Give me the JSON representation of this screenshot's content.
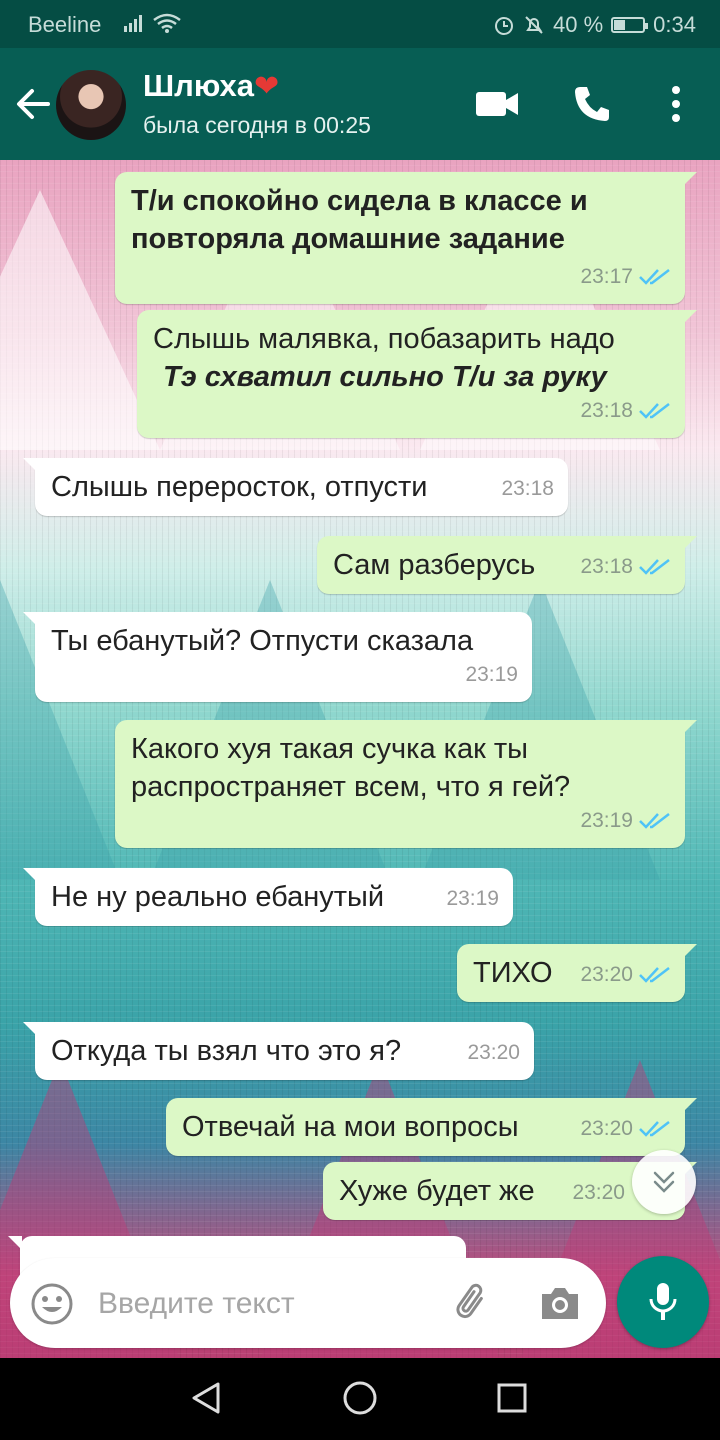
{
  "status_bar": {
    "carrier": "Beeline",
    "battery_text": "40 %",
    "battery_level": 0.4,
    "time": "0:34"
  },
  "header": {
    "contact_name": "Шлюха",
    "name_emoji": "❤",
    "last_seen": "была сегодня в 00:25",
    "icons": [
      "back-arrow-icon",
      "video-call-icon",
      "phone-icon",
      "more-vert-icon"
    ],
    "accent": "#075e54"
  },
  "messages": [
    {
      "dir": "out",
      "lines": [
        "Т/и спокойно сидела в классе и",
        "повторяла домашние задание"
      ],
      "bold": true,
      "time": "23:17",
      "read": true
    },
    {
      "dir": "out",
      "lines": [
        "Слышь малявка, побазарить надо",
        "Тэ схватил сильно Т/и за руку"
      ],
      "time": "23:18",
      "read": true
    },
    {
      "dir": "in",
      "lines": [
        "Слышь переросток, отпусти"
      ],
      "time": "23:18"
    },
    {
      "dir": "out",
      "lines": [
        "Сам разберусь"
      ],
      "time": "23:18",
      "read": true
    },
    {
      "dir": "in",
      "lines": [
        "Ты ебанутый? Отпусти сказала"
      ],
      "time": "23:19"
    },
    {
      "dir": "out",
      "lines": [
        "Какого хуя такая сучка как ты",
        "распространяет всем, что я гей?"
      ],
      "time": "23:19",
      "read": true
    },
    {
      "dir": "in",
      "lines": [
        "Не ну реально ебанутый"
      ],
      "time": "23:19"
    },
    {
      "dir": "out",
      "lines": [
        "ТИХО"
      ],
      "time": "23:20",
      "read": true
    },
    {
      "dir": "in",
      "lines": [
        "Откуда ты взял что это я?"
      ],
      "time": "23:20"
    },
    {
      "dir": "out",
      "lines": [
        "Отвечай на мои вопросы"
      ],
      "time": "23:20",
      "read": true
    },
    {
      "dir": "out",
      "lines": [
        "Хуже будет же"
      ],
      "time": "23:20",
      "read": true
    }
  ],
  "composer": {
    "placeholder": "Введите текст",
    "icons": [
      "emoji-icon",
      "attach-icon",
      "camera-icon",
      "mic-icon"
    ]
  },
  "colors": {
    "outgoing_bubble": "#dcf8c6",
    "incoming_bubble": "#ffffff",
    "read_ticks": "#4fc3f7",
    "mic_button": "#00897b"
  }
}
